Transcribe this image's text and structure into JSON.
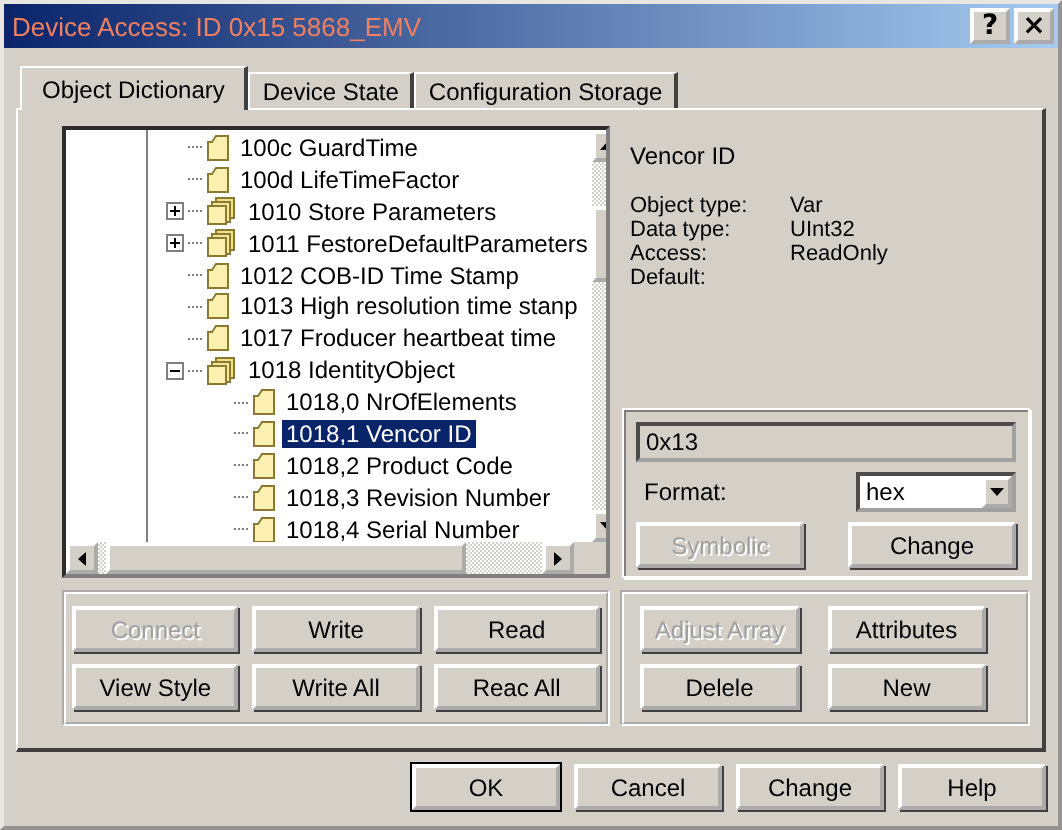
{
  "window": {
    "title": "Device Access: ID 0x15 5868_EMV",
    "help_button": "?",
    "close_button": "×"
  },
  "tabs": [
    {
      "label": "Object Dictionary",
      "selected": true
    },
    {
      "label": "Device State",
      "selected": false
    },
    {
      "label": "Configuration Storage",
      "selected": false
    }
  ],
  "tree": {
    "items": [
      {
        "label": "100c GuardTime",
        "kind": "object",
        "selected": false
      },
      {
        "label": "100d LifeTimeFactor",
        "kind": "object",
        "selected": false
      },
      {
        "label": "1010 Store Parameters",
        "kind": "group",
        "expanded": false,
        "selected": false
      },
      {
        "label": "1011 FestoreDefaultParameters",
        "kind": "group",
        "expanded": false,
        "selected": false
      },
      {
        "label": "1012 COB-ID Time Stamp",
        "kind": "object",
        "selected": false
      },
      {
        "label": "1013 High resolution time stanp",
        "kind": "object",
        "selected": false
      },
      {
        "label": "1017 Froducer heartbeat time",
        "kind": "object",
        "selected": false
      },
      {
        "label": "1018 IdentityObject",
        "kind": "group",
        "expanded": true,
        "selected": false,
        "children": [
          {
            "label": "1018,0 NrOfElements",
            "kind": "object",
            "selected": false
          },
          {
            "label": "1018,1 Vencor ID",
            "kind": "object",
            "selected": true
          },
          {
            "label": "1018,2 Product Code",
            "kind": "object",
            "selected": false
          },
          {
            "label": "1018,3 Revision Number",
            "kind": "object",
            "selected": false
          },
          {
            "label": "1018,4 Serial Number",
            "kind": "object",
            "selected": false
          }
        ]
      }
    ]
  },
  "details": {
    "title": "Vencor ID",
    "properties": [
      {
        "label": "Object type:",
        "value": "Var"
      },
      {
        "label": "Data type:",
        "value": "UInt32"
      },
      {
        "label": "Access:",
        "value": "ReadOnly"
      },
      {
        "label": "Default:"
      }
    ],
    "value": "0x13",
    "format_label": "Format:",
    "format": "hex",
    "buttons": [
      {
        "label": "Symbolic",
        "disabled": true
      },
      {
        "label": "Change",
        "disabled": false
      }
    ]
  },
  "left_buttons": [
    {
      "label": "Connect",
      "disabled": true
    },
    {
      "label": "Write",
      "disabled": false
    },
    {
      "label": "Read",
      "disabled": false
    },
    {
      "label": "View Style",
      "disabled": false
    },
    {
      "label": "Write All",
      "disabled": false
    },
    {
      "label": "Reac All",
      "disabled": false
    }
  ],
  "right_buttons": [
    {
      "label": "Adjust Array",
      "disabled": true
    },
    {
      "label": "Attributes",
      "disabled": false
    },
    {
      "label": "Delele",
      "disabled": false
    },
    {
      "label": "New",
      "disabled": false
    }
  ],
  "dialog_buttons": [
    {
      "label": "OK",
      "default": true
    },
    {
      "label": "Cancel",
      "default": false
    },
    {
      "label": "Change",
      "default": false
    },
    {
      "label": "Help",
      "default": false
    }
  ]
}
